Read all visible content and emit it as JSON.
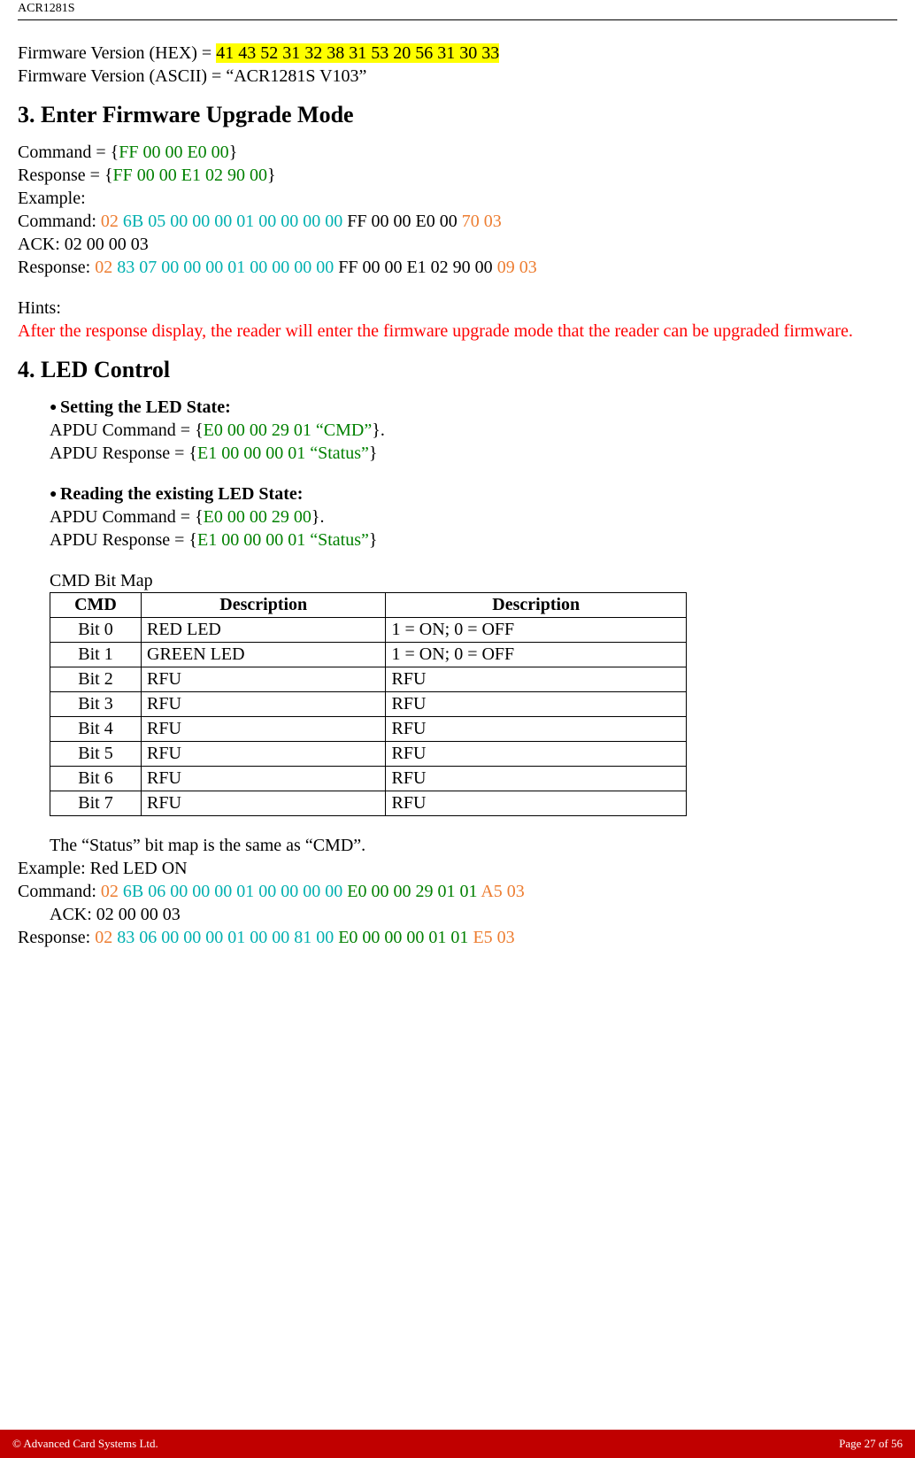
{
  "header": {
    "product": "ACR1281S"
  },
  "fw": {
    "hex_label": "Firmware Version (HEX) =  ",
    "hex_value": "41 43 52 31 32 38 31 53 20 56 31 30 33",
    "ascii_label": "Firmware Version (ASCII) = ",
    "ascii_value": "“ACR1281S V103”"
  },
  "sec3": {
    "title": "3. Enter Firmware Upgrade Mode",
    "cmd_label": "Command = {",
    "cmd_val": "FF 00 00 E0 00",
    "resp_label": "Response = {",
    "resp_val": "FF 00 00 E1 02 90 00",
    "example_label": "Example:",
    "ex_cmd_label": "Command: ",
    "ex_cmd_c1": "02",
    "ex_cmd_c2": "6B 05 00 00 00 01 00 00 00 00",
    "ex_cmd_c3": "FF 00 00 E0 00",
    "ex_cmd_c4": "70 03",
    "ack_label": "ACK:  ",
    "ack_val": "02 00 00 03",
    "ex_resp_label": "Response: ",
    "ex_resp_c1": "02",
    "ex_resp_c2": "83 07 00 00 00 01 00 00 00 00",
    "ex_resp_c3": "FF 00 00 E1 02 90 00",
    "ex_resp_c4": "09 03",
    "hints_label": "Hints:",
    "hints_text": "After the response display, the reader will enter the firmware upgrade mode that the reader can be upgraded firmware."
  },
  "sec4": {
    "title": "4.  LED Control",
    "set_title": "Setting the LED State:",
    "set_cmd_label": "APDU Command = {",
    "set_cmd_val": "E0 00 00 29 01 “CMD”",
    "set_resp_label": "APDU Response = {",
    "set_resp_val": "E1 00 00 00 01 “Status”",
    "read_title": "Reading the existing LED State:",
    "read_cmd_label": "APDU Command = {",
    "read_cmd_val": "E0 00 00 29 00",
    "read_resp_label": "APDU Response = {",
    "read_resp_val": "E1 00 00 00 01 “Status”",
    "bitmap_title": "CMD Bit Map",
    "table": {
      "headers": [
        "CMD",
        "Description",
        "Description"
      ],
      "rows": [
        [
          "Bit 0",
          "RED LED",
          "1 = ON; 0 = OFF"
        ],
        [
          "Bit 1",
          "GREEN LED",
          "1 = ON; 0 = OFF"
        ],
        [
          "Bit 2",
          "RFU",
          "RFU"
        ],
        [
          "Bit 3",
          "RFU",
          "RFU"
        ],
        [
          "Bit 4",
          "RFU",
          "RFU"
        ],
        [
          "Bit 5",
          "RFU",
          "RFU"
        ],
        [
          "Bit 6",
          "RFU",
          "RFU"
        ],
        [
          "Bit 7",
          "RFU",
          "RFU"
        ]
      ]
    },
    "status_note": "The “Status” bit map is the same as “CMD”.",
    "example2_label": "Example: Red LED ON",
    "ex2_cmd_label": "Command: ",
    "ex2_cmd_c1": "02",
    "ex2_cmd_c2": "6B 06 00 00 00 01 00 00 00 00",
    "ex2_cmd_c3": "E0 00 00 29 01 01",
    "ex2_cmd_c4": "A5 03",
    "ex2_ack_label": "ACK:  ",
    "ex2_ack_val": "02 00 00 03",
    "ex2_resp_label": "Response: ",
    "ex2_resp_c1": "02",
    "ex2_resp_c2": "83 06 00 00 00 01 00 00 81 00",
    "ex2_resp_c3": "E0 00 00 00 01 01",
    "ex2_resp_c4": "E5 03"
  },
  "footer": {
    "left": "© Advanced Card Systems Ltd.",
    "right": "Page 27 of 56"
  }
}
